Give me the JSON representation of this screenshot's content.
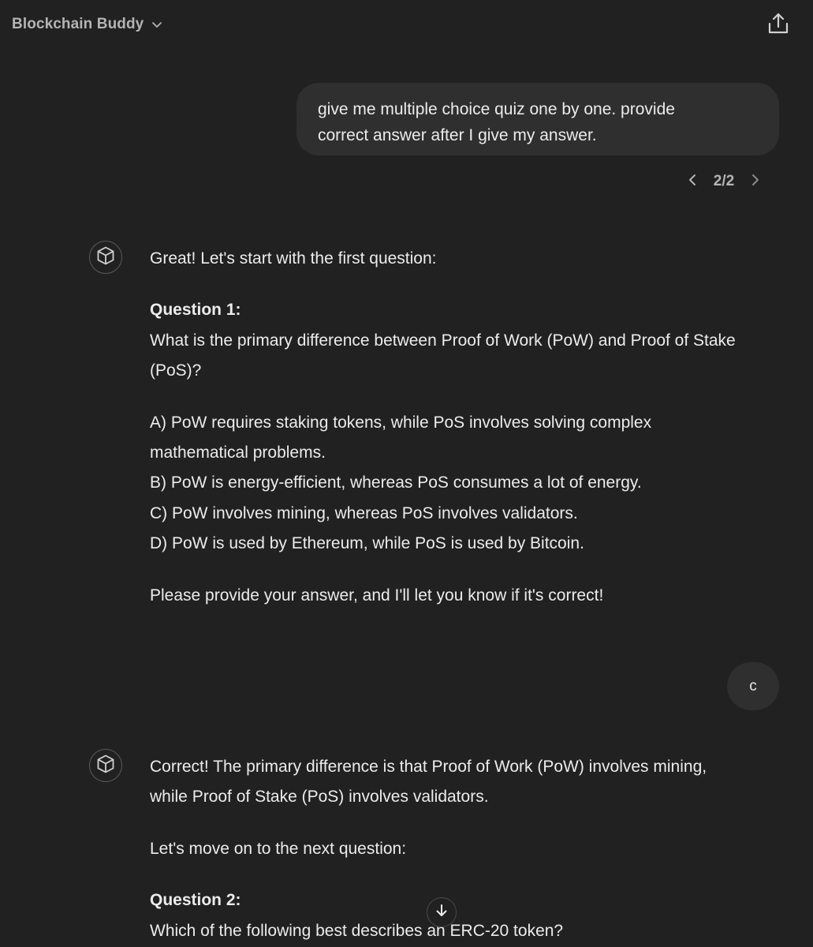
{
  "header": {
    "model_name": "Blockchain Buddy",
    "model_icon": "chevron-down-icon",
    "share_icon": "share-icon"
  },
  "user_message_1": {
    "line1": "give me multiple choice quiz one by one. provide",
    "line2": "correct answer after I give my answer."
  },
  "version_nav": {
    "text": "2/2",
    "prev_icon": "chevron-left-icon",
    "next_icon": "chevron-right-icon"
  },
  "assistant_message_1": {
    "intro": "Great! Let's start with the first question:",
    "question_title": "Question 1:",
    "question_line1": "What is the primary difference between Proof of Work (PoW) and Proof of Stake",
    "question_line2": "(PoS)?",
    "option_a_line1": "A) PoW requires staking tokens, while PoS involves solving complex",
    "option_a_line2": "mathematical problems.",
    "option_b": "B) PoW is energy-efficient, whereas PoS consumes a lot of energy.",
    "option_c": "C) PoW involves mining, whereas PoS involves validators.",
    "option_d": "D) PoW is used by Ethereum, while PoS is used by Bitcoin.",
    "closing": "Please provide your answer, and I'll let you know if it's correct!"
  },
  "user_message_2": {
    "text": "c"
  },
  "assistant_message_2": {
    "line1": "Correct! The primary difference is that Proof of Work (PoW) involves mining,",
    "line2": "while Proof of Stake (PoS) involves validators.",
    "transition": "Let's move on to the next question:",
    "question_title": "Question 2:",
    "question_text": "Which of the following best describes an ERC-20 token?"
  },
  "scroll_button_icon": "arrow-down-icon"
}
